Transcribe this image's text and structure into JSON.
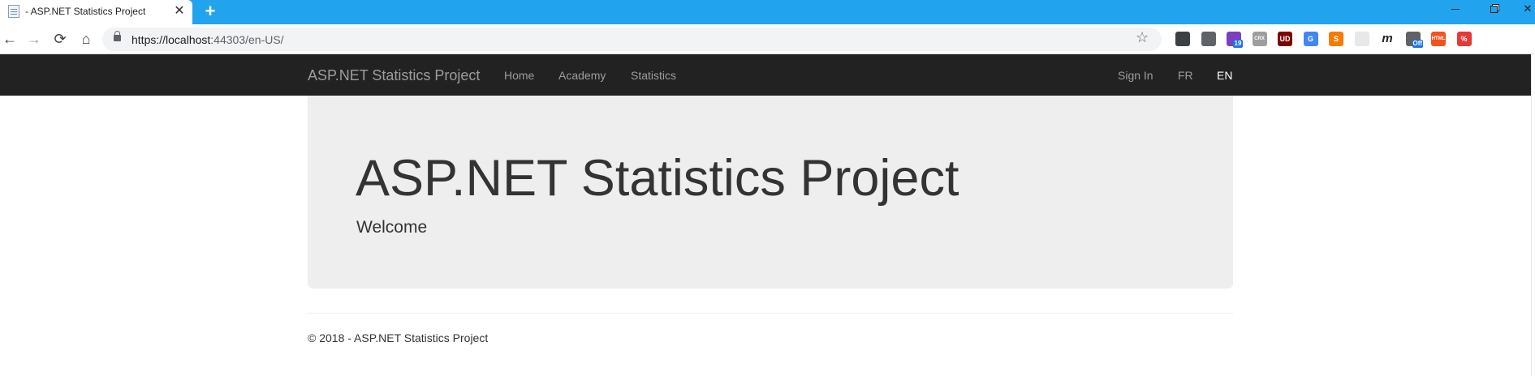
{
  "browser": {
    "tab_title": "- ASP.NET Statistics Project",
    "tab_close": "✕",
    "new_tab": "+",
    "url_host": "https://localhost",
    "url_rest": ":44303/en-US/",
    "back_glyph": "←",
    "forward_glyph": "→",
    "reload_glyph": "⟳",
    "home_glyph": "⌂",
    "star_glyph": "☆",
    "extensions": [
      {
        "icon": "eyedropper-extension-icon",
        "label": "",
        "color": "#3c4043",
        "badge": ""
      },
      {
        "icon": "clipboard-extension-icon",
        "label": "",
        "color": "#5f6368",
        "badge": ""
      },
      {
        "icon": "counter-extension-icon",
        "label": "",
        "color": "#7b3fbf",
        "badge": "19"
      },
      {
        "icon": "crx-extension-icon",
        "label": "CRX",
        "color": "#9e9e9e",
        "badge": ""
      },
      {
        "icon": "ublock-origin-icon",
        "label": "UD",
        "color": "#800000",
        "badge": ""
      },
      {
        "icon": "google-translate-icon",
        "label": "G",
        "color": "#4285f4",
        "badge": ""
      },
      {
        "icon": "sider-extension-icon",
        "label": "S",
        "color": "#f57c00",
        "badge": ""
      },
      {
        "icon": "blank-extension-icon",
        "label": "",
        "color": "#e8e8e8",
        "badge": ""
      },
      {
        "icon": "m-extension-icon",
        "label": "m",
        "color": "#ffffff",
        "badge": ""
      },
      {
        "icon": "cookie-extension-icon",
        "label": "",
        "color": "#5f6368",
        "badge": "Off"
      },
      {
        "icon": "html-extension-icon",
        "label": "HTML",
        "color": "#f4511e",
        "badge": ""
      },
      {
        "icon": "percent-extension-icon",
        "label": "%",
        "color": "#e53935",
        "badge": ""
      }
    ]
  },
  "navbar": {
    "brand": "ASP.NET Statistics Project",
    "links": [
      {
        "label": "Home"
      },
      {
        "label": "Academy"
      },
      {
        "label": "Statistics"
      }
    ],
    "right_links": [
      {
        "label": "Sign In"
      },
      {
        "label": "FR"
      },
      {
        "label": "EN"
      }
    ],
    "colors": {
      "background": "#222222",
      "link": "#9d9d9d",
      "active": "#ffffff"
    }
  },
  "jumbotron": {
    "title": "ASP.NET Statistics Project",
    "subtitle": "Welcome"
  },
  "footer": {
    "text": "© 2018 - ASP.NET Statistics Project"
  }
}
